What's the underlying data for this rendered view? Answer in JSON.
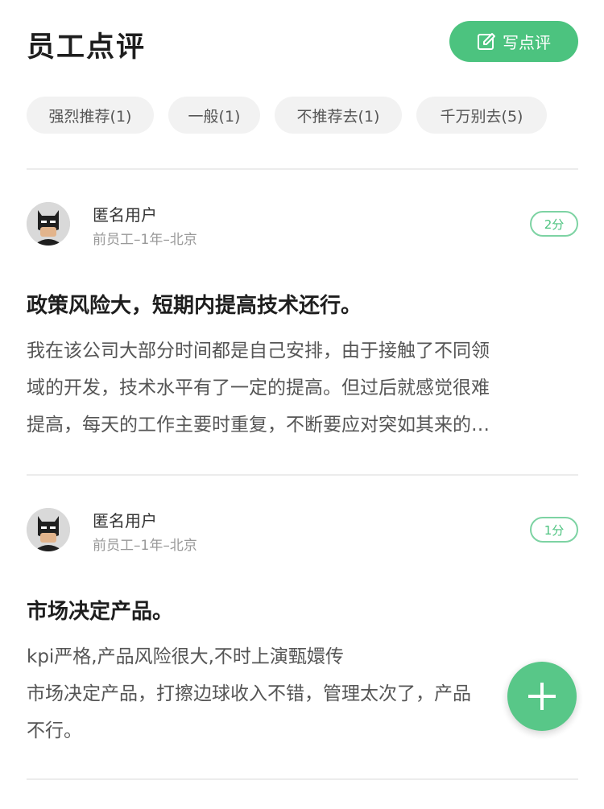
{
  "header": {
    "title": "员工点评",
    "write_button_label": "写点评",
    "accent_color": "#4cc37f"
  },
  "filters": [
    {
      "label": "强烈推荐(1)"
    },
    {
      "label": "一般(1)"
    },
    {
      "label": "不推荐去(1)"
    },
    {
      "label": "千万别去(5)"
    }
  ],
  "reviews": [
    {
      "author": "匿名用户",
      "meta": "前员工–1年–北京",
      "score": "2分",
      "avatar_icon": "batman-avatar-icon",
      "title": "政策风险大，短期内提高技术还行。",
      "body_lines": [
        "我在该公司大部分时间都是自己安排，由于接触了不同领",
        "域的开发，技术水平有了一定的提高。但过后就感觉很难",
        "提高，每天的工作主要时重复，不断要应对突如其来的…"
      ]
    },
    {
      "author": "匿名用户",
      "meta": "前员工–1年–北京",
      "score": "1分",
      "avatar_icon": "batman-avatar-icon",
      "title": "市场决定产品。",
      "body_lines": [
        "kpi严格,产品风险很大,不时上演甄嬛传",
        "市场决定产品，打擦边球收入不错，管理太次了，产品",
        "不行。"
      ]
    }
  ],
  "fab": {
    "icon": "plus-icon"
  }
}
